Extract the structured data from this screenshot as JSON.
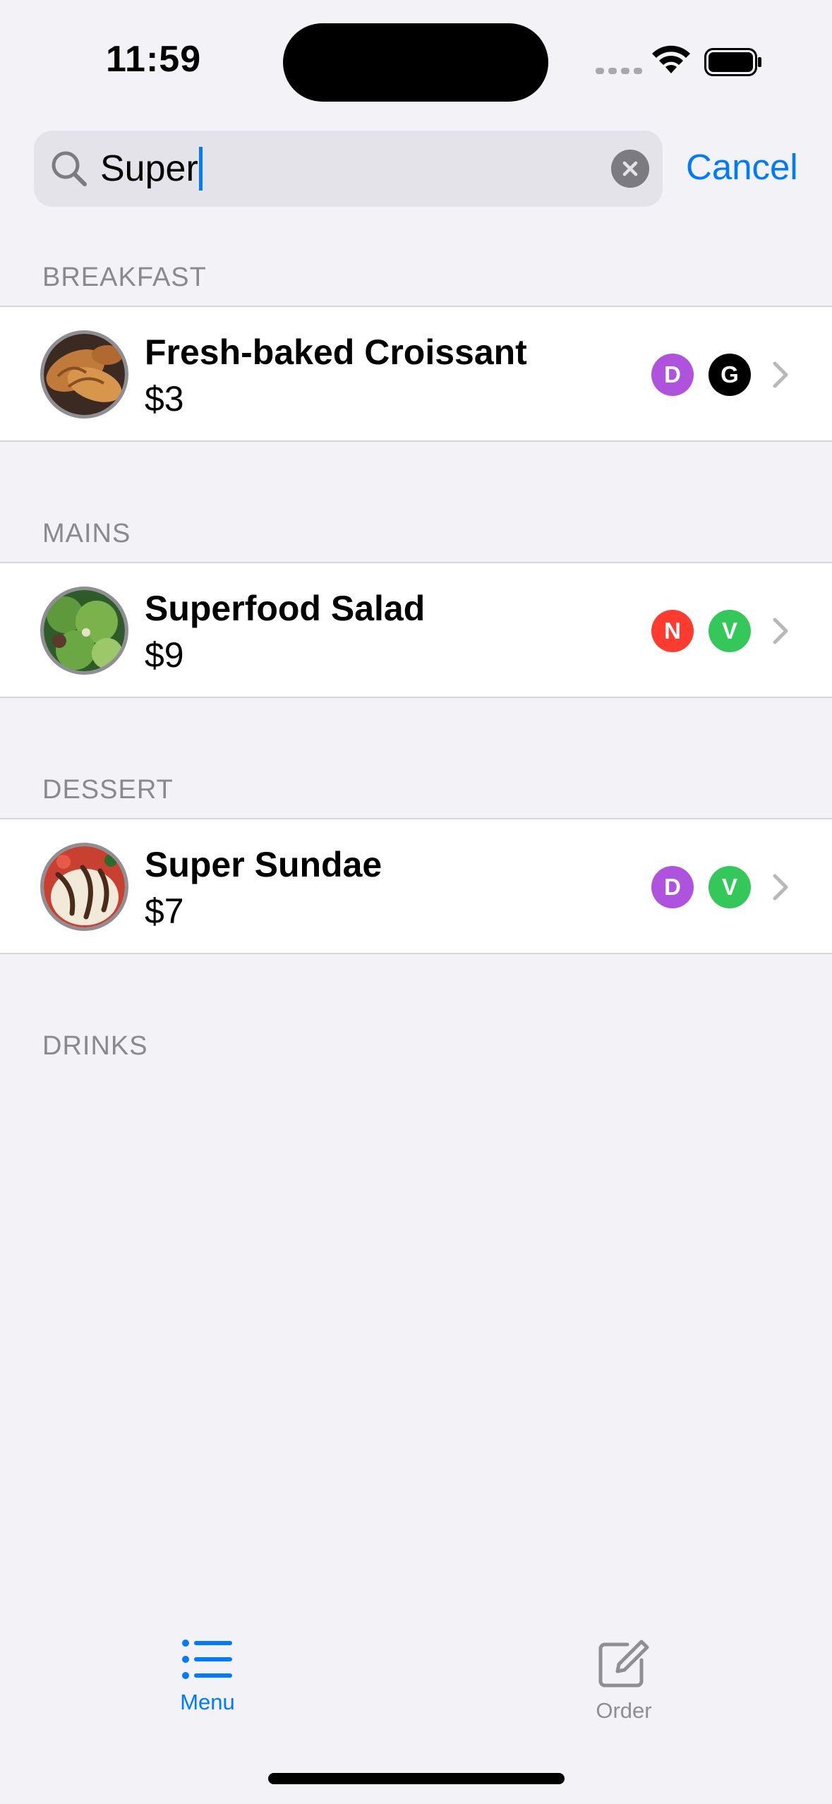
{
  "status_bar": {
    "time": "11:59"
  },
  "search": {
    "query": "Super",
    "cancel_label": "Cancel"
  },
  "sections": [
    {
      "title": "BREAKFAST",
      "items": [
        {
          "name": "Fresh-baked Croissant",
          "price": "$3",
          "badges": [
            {
              "letter": "D",
              "color": "#af52de"
            },
            {
              "letter": "G",
              "color": "#000000"
            }
          ]
        }
      ]
    },
    {
      "title": "MAINS",
      "items": [
        {
          "name": "Superfood Salad",
          "price": "$9",
          "badges": [
            {
              "letter": "N",
              "color": "#ff3b30"
            },
            {
              "letter": "V",
              "color": "#34c759"
            }
          ]
        }
      ]
    },
    {
      "title": "DESSERT",
      "items": [
        {
          "name": "Super Sundae",
          "price": "$7",
          "badges": [
            {
              "letter": "D",
              "color": "#af52de"
            },
            {
              "letter": "V",
              "color": "#34c759"
            }
          ]
        }
      ]
    },
    {
      "title": "DRINKS",
      "items": []
    }
  ],
  "tab_bar": {
    "tabs": [
      {
        "label": "Menu",
        "icon": "list-icon",
        "selected": true
      },
      {
        "label": "Order",
        "icon": "compose-icon",
        "selected": false
      }
    ]
  },
  "colors": {
    "accent": "#007aff",
    "background": "#f2f2f7",
    "inactive_tab": "#8e8e93"
  }
}
